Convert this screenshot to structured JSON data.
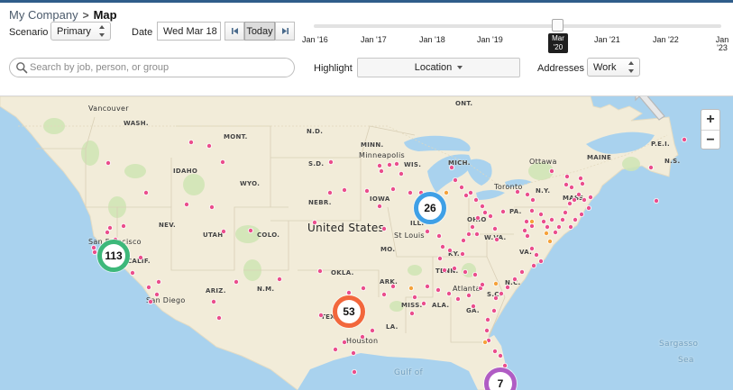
{
  "breadcrumb": {
    "parent": "My Company",
    "separator": ">",
    "current": "Map"
  },
  "scenario": {
    "label": "Scenario",
    "value": "Primary"
  },
  "date": {
    "label": "Date",
    "value": "Wed Mar 18",
    "today_label": "Today",
    "prev_icon": "skip-back-icon",
    "next_icon": "skip-forward-icon"
  },
  "timeline": {
    "ticks": [
      [
        "Jan '16"
      ],
      [
        "Jan '17"
      ],
      [
        "Jan '18"
      ],
      [
        "Jan '19"
      ],
      [
        "Jan '20"
      ],
      [
        "Jan '21"
      ],
      [
        "Jan '22"
      ],
      [
        "Jan",
        "'23"
      ]
    ],
    "tooltip": [
      "Mar",
      "'20"
    ]
  },
  "search": {
    "placeholder": "Search by job, person, or group",
    "icon": "search-icon"
  },
  "highlight": {
    "label": "Highlight",
    "value": "Location"
  },
  "addresses": {
    "label": "Addresses",
    "value": "Work"
  },
  "zoom": {
    "in": "+",
    "out": "−"
  },
  "map": {
    "labels": {
      "vancouver": "Vancouver",
      "wash": "WASH.",
      "mont": "MONT.",
      "nd": "N.D.",
      "minn": "MINN.",
      "ont": "ONT.",
      "maine": "MAINE",
      "pei": "P.E.I.",
      "ns": "N.S.",
      "minneapolis": "Minneapolis",
      "wis": "WIS.",
      "mich": "MICH.",
      "ottawa": "Ottawa",
      "idaho": "IDAHO",
      "wyo": "WYO.",
      "sd": "S.D.",
      "toronto": "Toronto",
      "ny": "N.Y.",
      "mass": "MASS.",
      "nebr": "NEBR.",
      "iowa": "IOWA",
      "ohio": "OHIO",
      "pa": "PA.",
      "nev": "NEV.",
      "utah": "UTAH",
      "colo": "COLO.",
      "united_states": "United States",
      "ill": "ILL.",
      "st_louis": "St Louis",
      "wva": "W.VA.",
      "san_francisco": "San Francisco",
      "calif": "CALIF.",
      "mo": "MO.",
      "ky": "KY.",
      "va": "VA.",
      "okla": "OKLA.",
      "ariz": "ARIZ.",
      "nm": "N.M.",
      "ark": "ARK.",
      "tenn": "TENN.",
      "nc": "N.C.",
      "san_diego": "San Diego",
      "atlanta": "Atlanta",
      "sc": "S.C.",
      "tex": "TEX.",
      "miss": "MISS.",
      "ala": "ALA.",
      "ga": "GA.",
      "la": "LA.",
      "houston": "Houston",
      "sargasso": "Sargasso",
      "sea": "Sea",
      "gulf": "Gulf of"
    },
    "clusters": [
      {
        "id": "midwest",
        "count": "26",
        "color": "#3fa0e6"
      },
      {
        "id": "california",
        "count": "113",
        "color": "#3db87a"
      },
      {
        "id": "texas",
        "count": "53",
        "color": "#f2673c"
      },
      {
        "id": "florida",
        "count": "7",
        "color": "#b05cc4"
      }
    ]
  },
  "colors": {
    "marker": "#ea4e8c",
    "marker_alt": "#f5a23b",
    "land": "#f2ecd9",
    "water": "#a9d2ee",
    "park": "#cfe5b4",
    "accent": "#2f5d8a"
  }
}
